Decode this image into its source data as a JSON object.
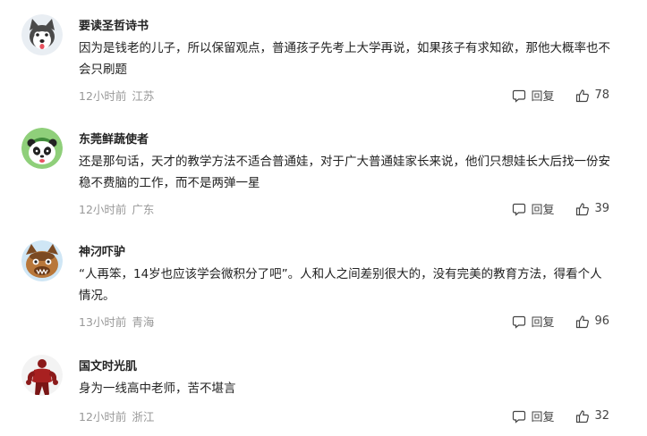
{
  "reply_label": "回复",
  "comments": [
    {
      "username": "要读圣哲诗书",
      "text": "因为是钱老的儿子，所以保留观点，普通孩子先考上大学再说，如果孩子有求知欲，那他大概率也不会只刷题",
      "time": "12小时前",
      "location": "江苏",
      "likes": "78"
    },
    {
      "username": "东莞鲜蔬使者",
      "text": "还是那句话，天才的教学方法不适合普通娃，对于广大普通娃家长来说，他们只想娃长大后找一份安稳不费脑的工作，而不是两弹一星",
      "time": "12小时前",
      "location": "广东",
      "likes": "39"
    },
    {
      "username": "神汈吓驴",
      "text": "“人再笨，14岁也应该学会微积分了吧”。人和人之间差别很大的，没有完美的教育方法，得看个人情况。",
      "time": "13小时前",
      "location": "青海",
      "likes": "96"
    },
    {
      "username": "国文时光肌",
      "text": "身为一线高中老师，苦不堪言",
      "time": "12小时前",
      "location": "浙江",
      "likes": "32"
    }
  ]
}
